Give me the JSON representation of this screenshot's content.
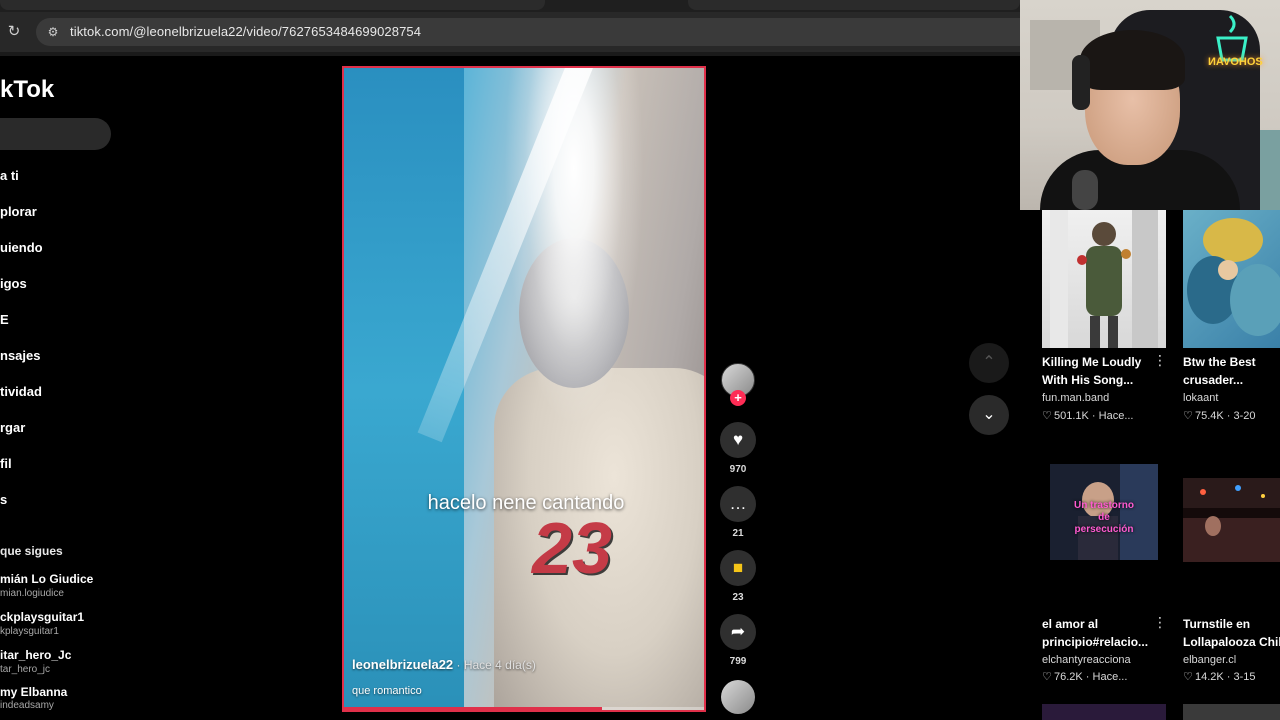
{
  "browser": {
    "url": "tiktok.com/@leonelbrizuela22/video/7627653484699028754"
  },
  "tiktok": {
    "logo": "kTok",
    "nav": [
      "a ti",
      "plorar",
      "uiendo",
      "igos",
      "E",
      "nsajes",
      "tividad",
      "rgar",
      "fil",
      "s"
    ],
    "following_heading": "que sigues",
    "accounts": [
      {
        "name": "mián Lo Giudice",
        "handle": "mian.logiudice"
      },
      {
        "name": "ckplaysguitar1",
        "handle": "kplaysguitar1"
      },
      {
        "name": "itar_hero_Jc",
        "handle": "tar_hero_jc"
      },
      {
        "name": "my Elbanna",
        "handle": "indeadsamy"
      }
    ]
  },
  "video": {
    "overlay_text": "hacelo nene cantando",
    "author": "leonelbrizuela22",
    "time": " · Hace 4 día(s)",
    "description": "que romantico",
    "jersey_number": "23",
    "progress": 0.71
  },
  "actions": {
    "follow_plus": "+",
    "likes": "970",
    "comments": "21",
    "saves": "23",
    "shares": "799"
  },
  "webcam": {
    "neon_text": "ИAVOHOS"
  },
  "recommendations": [
    {
      "title": "Killing Me Loudly\nWith His Song...",
      "author": "fun.man.band",
      "meta": "501.1K · Hace..."
    },
    {
      "title": "Btw the Best\ncrusader...",
      "author": "lokaant",
      "meta": "75.4K · 3-20"
    },
    {
      "title": "el amor al\nprincipio#relacio...",
      "author": "elchantyreacciona",
      "meta": "76.2K · Hace..."
    },
    {
      "title": "Turnstile en\nLollapalooza Chil",
      "author": "elbanger.cl",
      "meta": "14.2K · 3-15"
    }
  ],
  "rec2_overlay": "Un trastorno de persecución",
  "icons": {
    "reload": "reload-icon",
    "site_info": "site-info-icon",
    "heart": "heart-icon",
    "comment": "comment-icon",
    "bookmark": "bookmark-icon",
    "share": "share-icon",
    "up": "chevron-up-icon",
    "down": "chevron-down-icon"
  },
  "colors": {
    "accent": "#fe2c55",
    "bookmark": "#f5c518"
  }
}
